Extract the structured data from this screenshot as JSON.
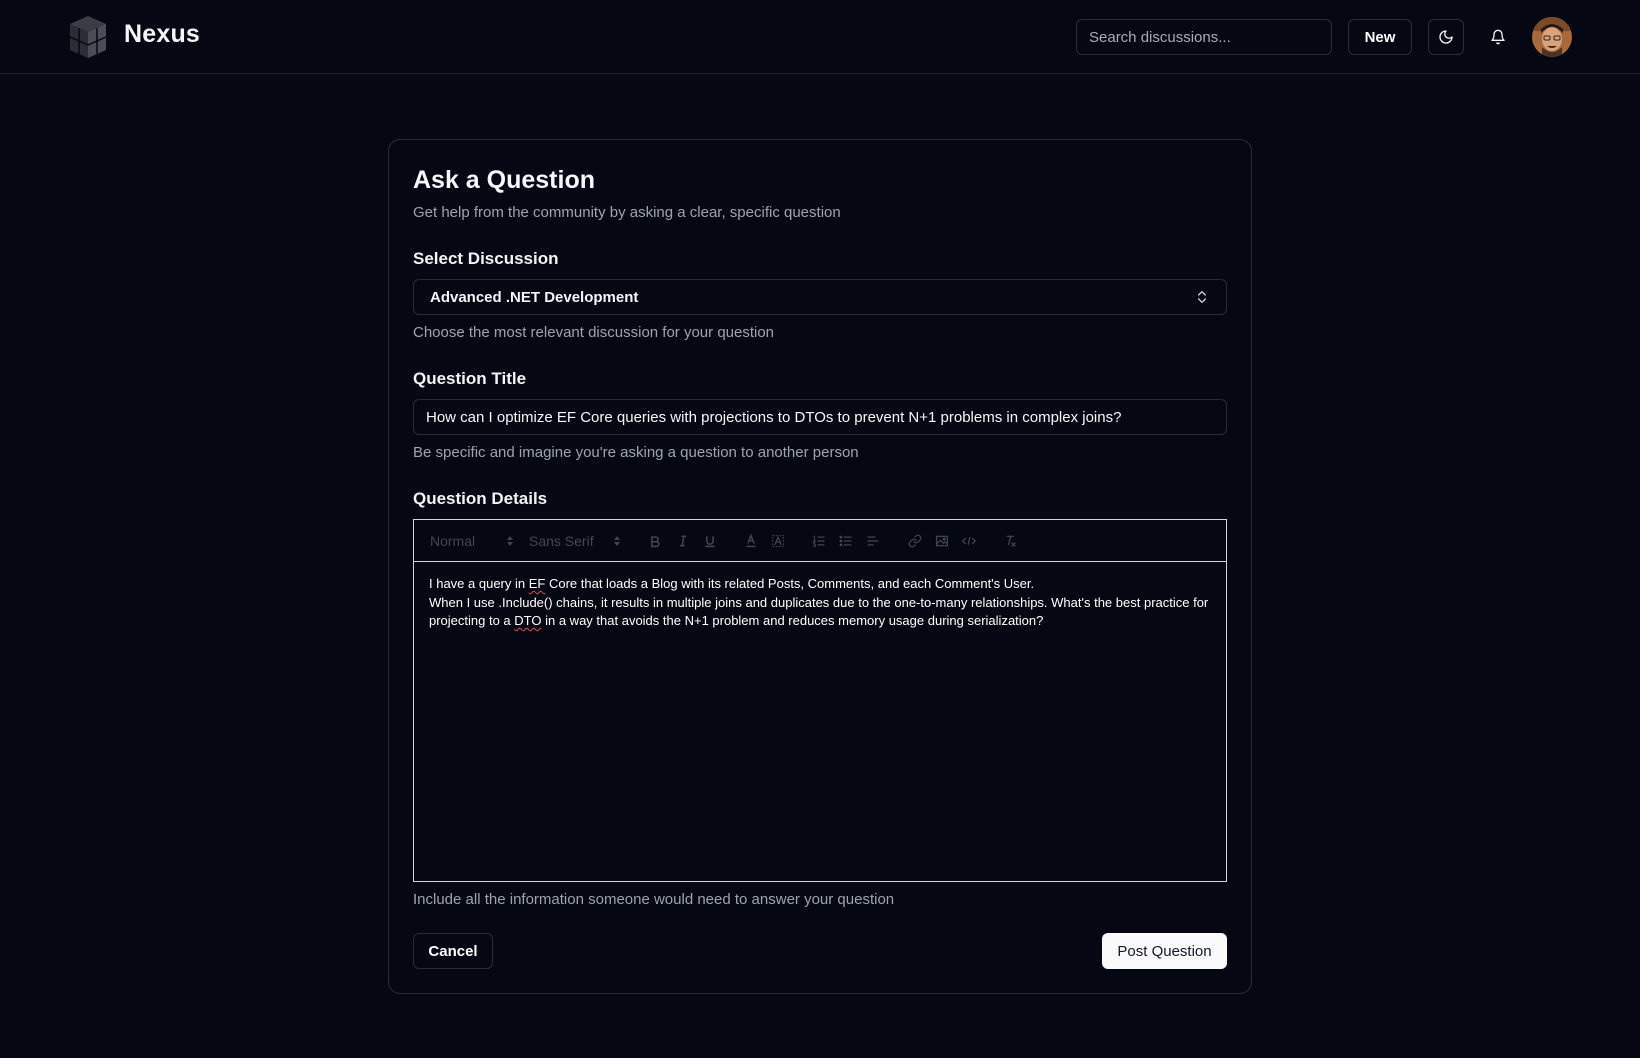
{
  "header": {
    "brand": "Nexus",
    "search_placeholder": "Search discussions...",
    "new_label": "New"
  },
  "form": {
    "title": "Ask a Question",
    "subtitle": "Get help from the community by asking a clear, specific question",
    "discussion": {
      "label": "Select Discussion",
      "selected": "Advanced .NET Development",
      "hint": "Choose the most relevant discussion for your question"
    },
    "question_title": {
      "label": "Question Title",
      "value": "How can I optimize EF Core queries with projections to DTOs to prevent N+1 problems in complex joins?",
      "hint": "Be specific and imagine you're asking a question to another person"
    },
    "details": {
      "label": "Question Details",
      "toolbar": {
        "header_select": "Normal",
        "font_select": "Sans Serif"
      },
      "body": {
        "line1_a": "I have a query in ",
        "line1_ef": "EF",
        "line1_b": " Core that loads a Blog with its related Posts, Comments, and each Comment's User.",
        "line2_a": "When I use .Include() chains, it results in multiple joins and duplicates due to the one-to-many relationships. What's the best practice for projecting to a ",
        "line2_dto": "DTO",
        "line2_b": " in a way that avoids the N+1 problem and reduces memory usage during serialization?"
      },
      "hint": "Include all the information someone would need to answer your question"
    },
    "cancel_label": "Cancel",
    "submit_label": "Post Question"
  },
  "icons": {
    "logo": "cube-logo-icon",
    "theme": "moon-icon",
    "notifications": "bell-icon"
  }
}
